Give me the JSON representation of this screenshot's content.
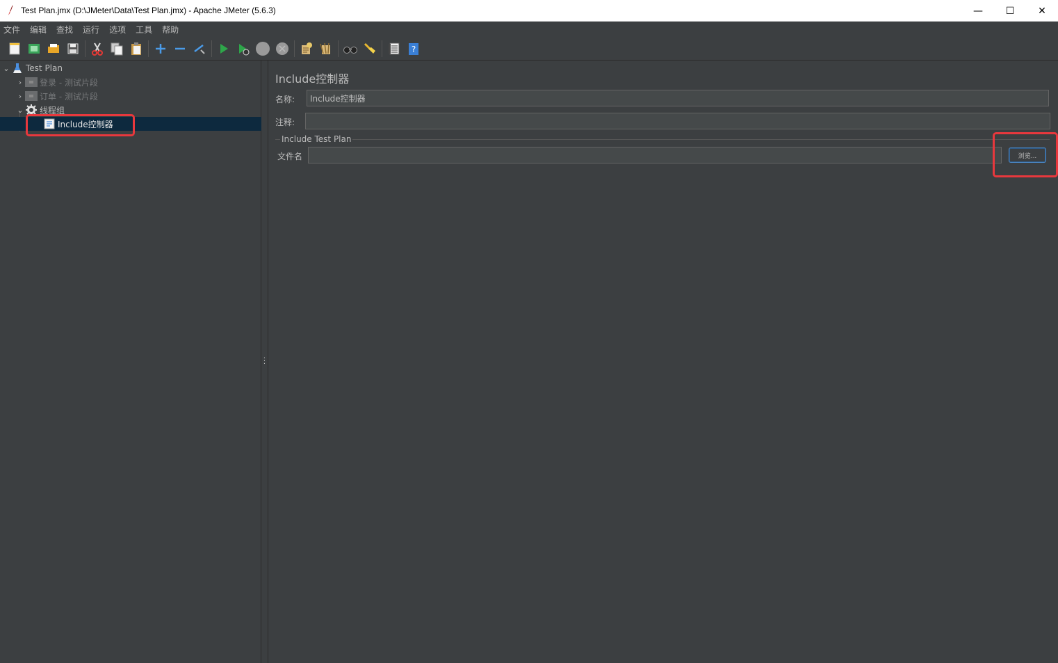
{
  "window": {
    "title": "Test Plan.jmx (D:\\JMeter\\Data\\Test Plan.jmx) - Apache JMeter (5.6.3)",
    "controls": [
      "—",
      "☐",
      "✕"
    ]
  },
  "menu": [
    "文件",
    "编辑",
    "查找",
    "运行",
    "选项",
    "工具",
    "帮助"
  ],
  "toolbar": {
    "icons": [
      "new-icon",
      "templates-icon",
      "open-icon",
      "save-icon",
      "cut-icon",
      "copy-icon",
      "paste-icon",
      "expand-icon",
      "collapse-icon",
      "toggle-icon",
      "start-icon",
      "start-no-pause-icon",
      "stop-icon",
      "shutdown-icon",
      "clear-icon",
      "clear-all-icon",
      "search-icon",
      "reset-search-icon",
      "function-helper-icon",
      "help-icon"
    ]
  },
  "tree": {
    "root": "Test Plan",
    "items": [
      {
        "label": "登录 - 测试片段",
        "disabled": true
      },
      {
        "label": "订单 - 测试片段",
        "disabled": true
      },
      {
        "label": "线程组",
        "disabled": false
      },
      {
        "label": "Include控制器",
        "selected": true
      }
    ]
  },
  "form": {
    "title": "Include控制器",
    "name_label": "名称:",
    "name_value": "Include控制器",
    "comment_label": "注释:",
    "comment_value": "",
    "group_title": "Include Test Plan",
    "filename_label": "文件名",
    "filename_value": "",
    "browse_label": "浏览..."
  },
  "colors": {
    "background": "#3c3f41",
    "field_bg": "#45494a",
    "selection": "#0d293e",
    "highlight": "#e8383d",
    "focus": "#4a88c7"
  }
}
